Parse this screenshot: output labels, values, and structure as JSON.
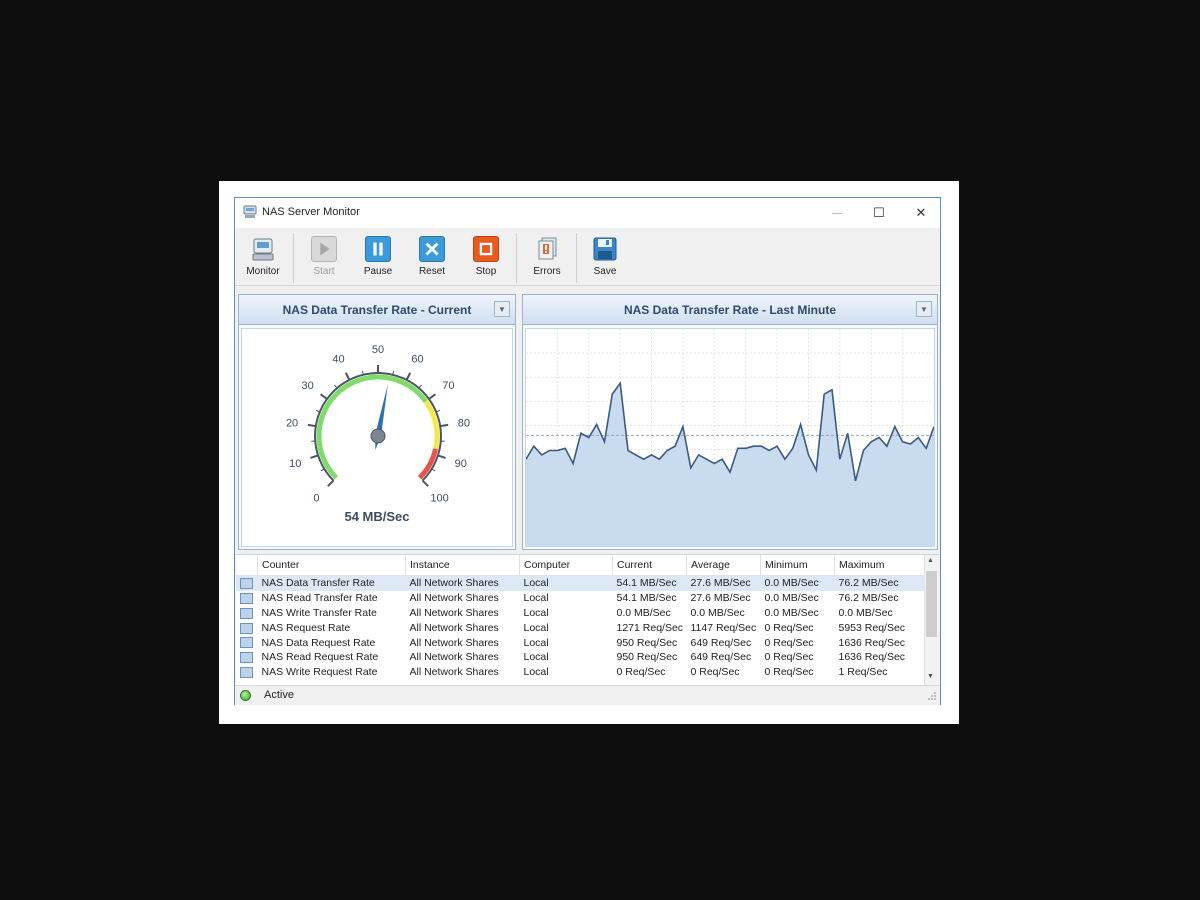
{
  "window": {
    "title": "NAS Server Monitor",
    "controls": {
      "minimize": "—",
      "maximize": "☐",
      "close": "✕"
    }
  },
  "toolbar": {
    "buttons": [
      {
        "label": "Monitor",
        "icon": "monitor-icon",
        "enabled": true
      },
      {
        "label": "Start",
        "icon": "play-icon",
        "enabled": false
      },
      {
        "label": "Pause",
        "icon": "pause-icon",
        "enabled": true
      },
      {
        "label": "Reset",
        "icon": "reset-icon",
        "enabled": true
      },
      {
        "label": "Stop",
        "icon": "stop-icon",
        "enabled": true
      },
      {
        "label": "Errors",
        "icon": "errors-icon",
        "enabled": true
      },
      {
        "label": "Save",
        "icon": "save-icon",
        "enabled": true
      }
    ]
  },
  "gauge_panel": {
    "title": "NAS Data Transfer Rate - Current",
    "readout": "54 MB/Sec",
    "ticks": [
      "0",
      "10",
      "20",
      "30",
      "40",
      "50",
      "60",
      "70",
      "80",
      "90",
      "100"
    ],
    "value": 54,
    "min": 0,
    "max": 100
  },
  "chart_panel": {
    "title": "NAS Data Transfer Rate - Last Minute"
  },
  "chart_data": {
    "type": "area",
    "title": "NAS Data Transfer Rate - Last Minute",
    "ylim": [
      0,
      100
    ],
    "average": 51,
    "grid": true,
    "values": [
      40,
      46,
      42,
      44,
      44,
      45,
      38,
      52,
      50,
      56,
      48,
      70,
      75,
      44,
      42,
      40,
      42,
      40,
      44,
      46,
      55,
      36,
      42,
      40,
      38,
      40,
      34,
      45,
      45,
      46,
      46,
      44,
      46,
      40,
      45,
      56,
      42,
      35,
      70,
      72,
      40,
      52,
      30,
      44,
      48,
      50,
      46,
      55,
      48,
      47,
      50,
      45,
      55
    ]
  },
  "table": {
    "columns": [
      "Counter",
      "Instance",
      "Computer",
      "Current",
      "Average",
      "Minimum",
      "Maximum"
    ],
    "rows": [
      [
        "NAS Data Transfer Rate",
        "All Network Shares",
        "Local",
        "54.1 MB/Sec",
        "27.6 MB/Sec",
        "0.0 MB/Sec",
        "76.2 MB/Sec"
      ],
      [
        "NAS Read Transfer Rate",
        "All Network Shares",
        "Local",
        "54.1 MB/Sec",
        "27.6 MB/Sec",
        "0.0 MB/Sec",
        "76.2 MB/Sec"
      ],
      [
        "NAS Write Transfer Rate",
        "All Network Shares",
        "Local",
        "0.0 MB/Sec",
        "0.0 MB/Sec",
        "0.0 MB/Sec",
        "0.0 MB/Sec"
      ],
      [
        "NAS Request Rate",
        "All Network Shares",
        "Local",
        "1271 Req/Sec",
        "1147 Req/Sec",
        "0 Req/Sec",
        "5953 Req/Sec"
      ],
      [
        "NAS Data Request Rate",
        "All Network Shares",
        "Local",
        "950 Req/Sec",
        "649 Req/Sec",
        "0 Req/Sec",
        "1636 Req/Sec"
      ],
      [
        "NAS Read Request Rate",
        "All Network Shares",
        "Local",
        "950 Req/Sec",
        "649 Req/Sec",
        "0 Req/Sec",
        "1636 Req/Sec"
      ],
      [
        "NAS Write Request Rate",
        "All Network Shares",
        "Local",
        "0 Req/Sec",
        "0 Req/Sec",
        "0 Req/Sec",
        "1 Req/Sec"
      ]
    ]
  },
  "status": {
    "text": "Active"
  },
  "colors": {
    "accent": "#2e4a6e",
    "chart_line": "#3b5a82",
    "chart_fill": "#c9dbef",
    "gauge_green": "#7fdc6a",
    "gauge_yellow": "#f4e94a",
    "gauge_red": "#e8534a"
  }
}
